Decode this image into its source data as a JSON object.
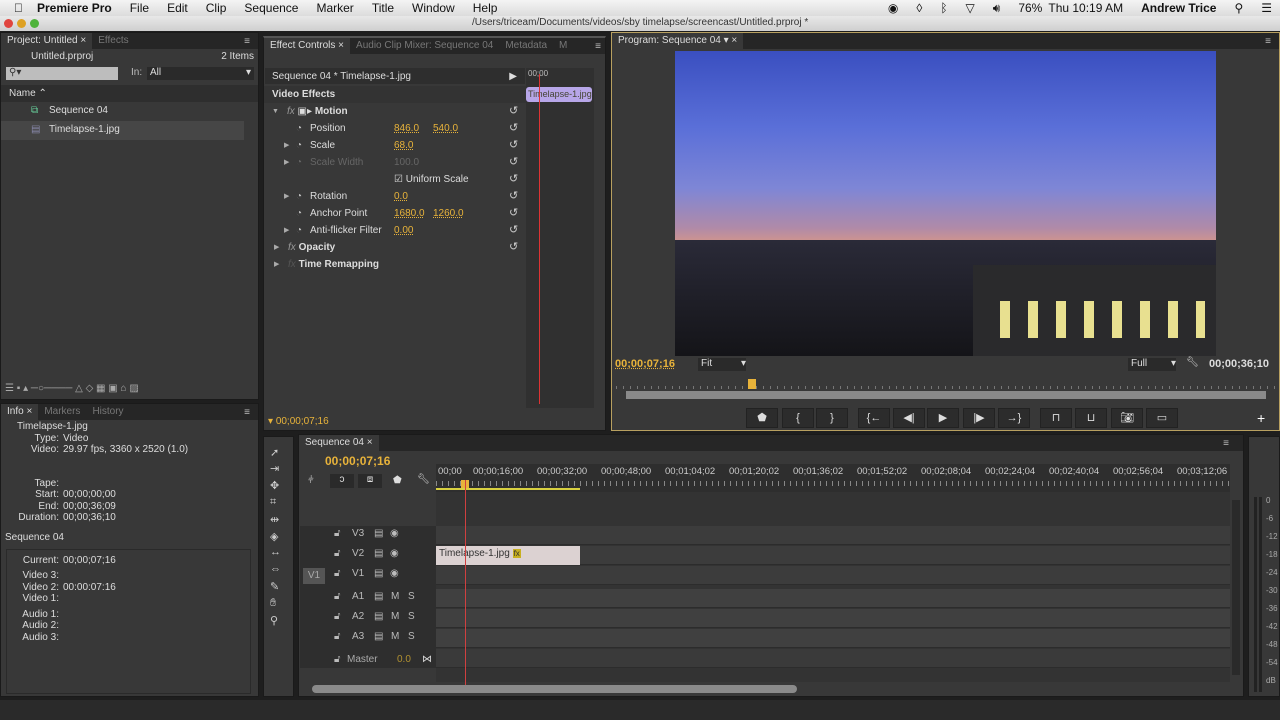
{
  "menubar": {
    "app": "Premiere Pro",
    "items": [
      "File",
      "Edit",
      "Clip",
      "Sequence",
      "Marker",
      "Title",
      "Window",
      "Help"
    ],
    "battery": "76%",
    "clock": "Thu 10:19 AM",
    "user": "Andrew Trice"
  },
  "titlebar": {
    "path": "/Users/triceam/Documents/videos/sby timelapse/screencast/Untitled.prproj *"
  },
  "project": {
    "tabs": [
      "Project: Untitled",
      "Effects"
    ],
    "file": "Untitled.prproj",
    "count": "2 Items",
    "in_label": "In:",
    "in_value": "All",
    "col_name": "Name",
    "items": [
      "Sequence 04",
      "Timelapse-1.jpg"
    ]
  },
  "effect_controls": {
    "tabs": [
      "Effect Controls",
      "Audio Clip Mixer: Sequence 04",
      "Metadata",
      "M"
    ],
    "header": "Sequence 04 * Timelapse-1.jpg",
    "ruler_time": "00;00",
    "clip_label": "Timelapse-1.jpg",
    "section": "Video Effects",
    "motion": "Motion",
    "props": [
      {
        "name": "Position",
        "v1": "846.0",
        "v2": "540.0"
      },
      {
        "name": "Scale",
        "v1": "68.0"
      },
      {
        "name": "Scale Width",
        "v1": "100.0"
      },
      {
        "name": "Uniform Scale"
      },
      {
        "name": "Rotation",
        "v1": "0.0"
      },
      {
        "name": "Anchor Point",
        "v1": "1680.0",
        "v2": "1260.0"
      },
      {
        "name": "Anti-flicker Filter",
        "v1": "0.00"
      }
    ],
    "opacity": "Opacity",
    "time_remap": "Time Remapping",
    "timecode": "00;00;07;16"
  },
  "program": {
    "tab": "Program: Sequence 04",
    "timecode": "00;00;07;16",
    "zoom": "Fit",
    "quality": "Full",
    "duration": "00;00;36;10"
  },
  "info": {
    "tabs": [
      "Info",
      "Markers",
      "History"
    ],
    "clip": "Timelapse-1.jpg",
    "lines": [
      [
        "Type:",
        "Video"
      ],
      [
        "Video:",
        "29.97 fps, 3360 x 2520 (1.0)"
      ],
      [
        "Tape:",
        ""
      ],
      [
        "Start:",
        "00;00;00;00"
      ],
      [
        "End:",
        "00;00;36;09"
      ],
      [
        "Duration:",
        "00;00;36;10"
      ]
    ],
    "sequence": "Sequence 04",
    "seq_lines": [
      [
        "Current:",
        "00;00;07;16"
      ],
      [
        "Video 3:",
        ""
      ],
      [
        "Video 2:",
        "00:00:07:16"
      ],
      [
        "Video 1:",
        ""
      ],
      [
        "Audio 1:",
        ""
      ],
      [
        "Audio 2:",
        ""
      ],
      [
        "Audio 3:",
        ""
      ]
    ]
  },
  "timeline": {
    "tab": "Sequence 04",
    "timecode": "00;00;07;16",
    "ruler": [
      "00;00",
      "00;00;16;00",
      "00;00;32;00",
      "00;00;48;00",
      "00;01;04;02",
      "00;01;20;02",
      "00;01;36;02",
      "00;01;52;02",
      "00;02;08;04",
      "00;02;24;04",
      "00;02;40;04",
      "00;02;56;04",
      "00;03;12;06"
    ],
    "source_patch": "V1",
    "video_tracks": [
      "V3",
      "V2",
      "V1"
    ],
    "audio_tracks": [
      "A1",
      "A2",
      "A3"
    ],
    "m": "M",
    "s": "S",
    "master": "Master",
    "master_vol": "0.0",
    "clip": "Timelapse-1.jpg",
    "fx": "fx"
  },
  "meter": {
    "ticks": [
      "0",
      "-6",
      "-12",
      "-18",
      "-24",
      "-30",
      "-36",
      "-42",
      "-48",
      "-54",
      "dB"
    ]
  }
}
